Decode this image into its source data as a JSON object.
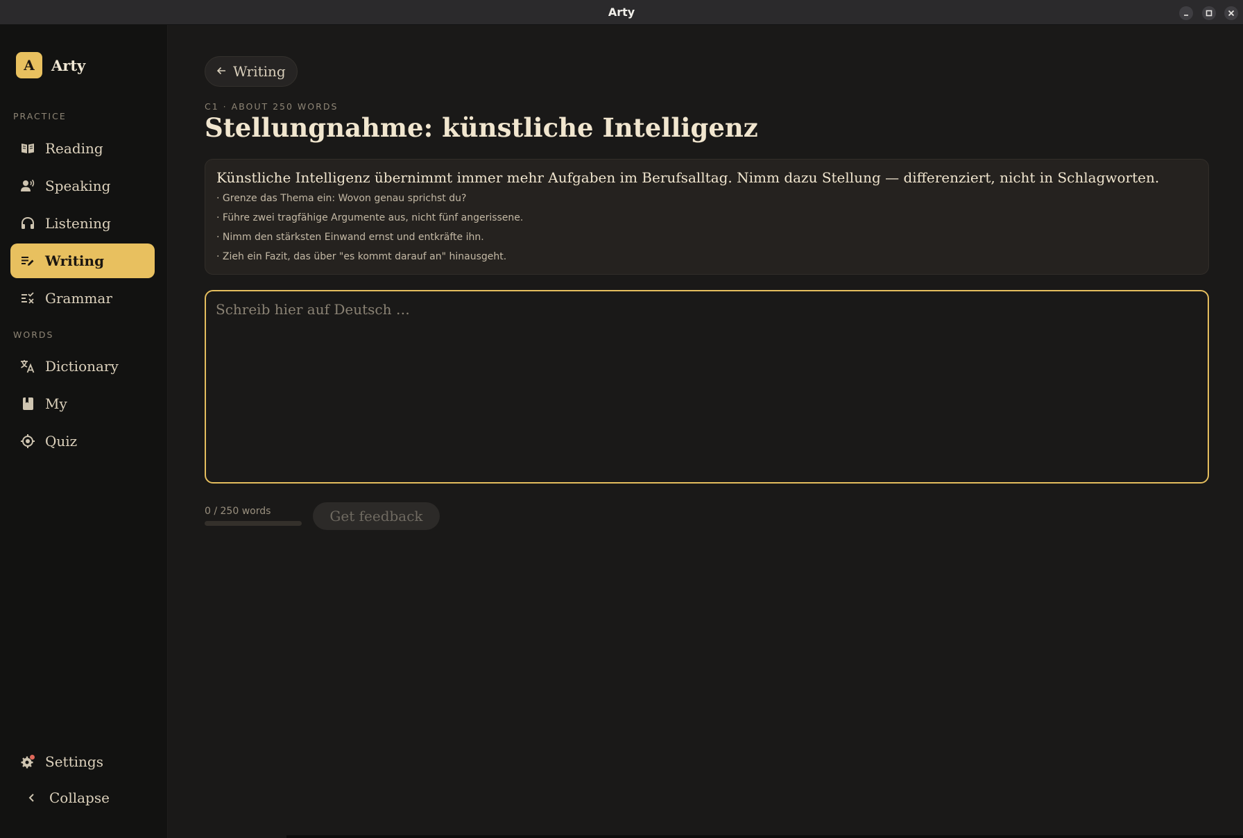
{
  "window": {
    "title": "Arty"
  },
  "sidebar": {
    "brand": {
      "logo_letter": "A",
      "name": "Arty"
    },
    "sections": [
      {
        "label": "PRACTICE"
      },
      {
        "label": "WORDS"
      }
    ],
    "items": [
      {
        "label": "Reading",
        "icon": "book-open-icon",
        "active": false
      },
      {
        "label": "Speaking",
        "icon": "speaking-person-icon",
        "active": false
      },
      {
        "label": "Listening",
        "icon": "headphones-icon",
        "active": false
      },
      {
        "label": "Writing",
        "icon": "edit-lines-icon",
        "active": true
      },
      {
        "label": "Grammar",
        "icon": "checklist-icon",
        "active": false
      },
      {
        "label": "Dictionary",
        "icon": "translate-icon",
        "active": false
      },
      {
        "label": "My",
        "icon": "bookmark-book-icon",
        "active": false
      },
      {
        "label": "Quiz",
        "icon": "target-icon",
        "active": false
      }
    ],
    "footer": [
      {
        "label": "Settings",
        "icon": "gear-with-dot-icon"
      },
      {
        "label": "Collapse",
        "icon": "chevron-left-icon"
      }
    ]
  },
  "main": {
    "back_label": "Writing",
    "meta": "C1 · ABOUT 250 WORDS",
    "title": "Stellungnahme: künstliche Intelligenz",
    "prompt": {
      "main": "Künstliche Intelligenz übernimmt immer mehr Aufgaben im Berufsalltag. Nimm dazu Stellung — differenziert, nicht in Schlagworten.",
      "points": [
        "· Grenze das Thema ein: Wovon genau sprichst du?",
        "· Führe zwei tragfähige Argumente aus, nicht fünf angerissene.",
        "· Nimm den stärksten Einwand ernst und entkräfte ihn.",
        "· Zieh ein Fazit, das über \"es kommt darauf an\" hinausgeht."
      ]
    },
    "editor": {
      "placeholder": "Schreib hier auf Deutsch …",
      "value": ""
    },
    "word_count": {
      "text": "0 / 250 words",
      "progress": 0
    },
    "feedback_label": "Get feedback"
  },
  "colors": {
    "accent": "#e8c05f",
    "background": "#1a1918",
    "sidebar": "#121211",
    "notification_dot": "#e0685a"
  }
}
